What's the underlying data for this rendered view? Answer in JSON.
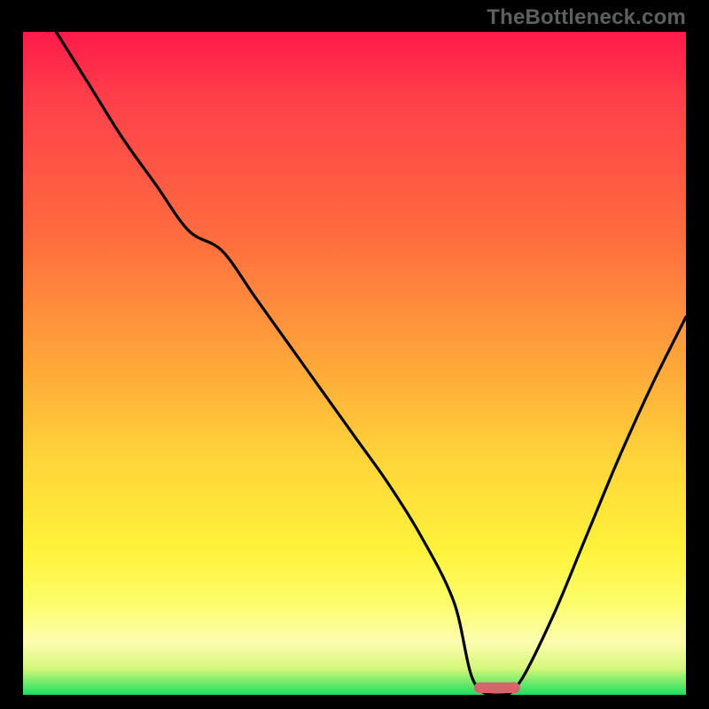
{
  "watermark": {
    "text": "TheBottleneck.com"
  },
  "colors": {
    "stop0": "#ff1a4a",
    "stop1": "#ff3f4a",
    "stop2": "#ff6a3f",
    "stop3": "#ffa63a",
    "stop4": "#ffd63a",
    "stop5": "#fff23a",
    "stop6": "#fdfd6a",
    "stop7": "#fdfdb0",
    "stop8": "#d6f77a",
    "stop9": "#1adf5f",
    "curve": "#000000",
    "marker": "#d9636b"
  },
  "chart_data": {
    "type": "line",
    "title": "",
    "xlabel": "",
    "ylabel": "",
    "xlim": [
      0,
      100
    ],
    "ylim": [
      0,
      100
    ],
    "grid": false,
    "legend_position": "none",
    "gradient_axis": "vertical",
    "gradient_meaning": "top = severe bottleneck (red), bottom = optimal (green)",
    "optimal_x_range": [
      68,
      75
    ],
    "series": [
      {
        "name": "bottleneck-curve",
        "x": [
          5,
          10,
          15,
          20,
          25,
          30,
          35,
          40,
          45,
          50,
          55,
          60,
          65,
          68,
          72,
          75,
          80,
          85,
          90,
          95,
          100
        ],
        "values": [
          100,
          92,
          84,
          77,
          70,
          67,
          60,
          53,
          46,
          39,
          32,
          24,
          14,
          2,
          0,
          2,
          12,
          24,
          36,
          47,
          57
        ]
      }
    ],
    "annotations": []
  },
  "marker": {
    "x_start_pct": 68,
    "x_end_pct": 75,
    "y_pct": 0
  }
}
